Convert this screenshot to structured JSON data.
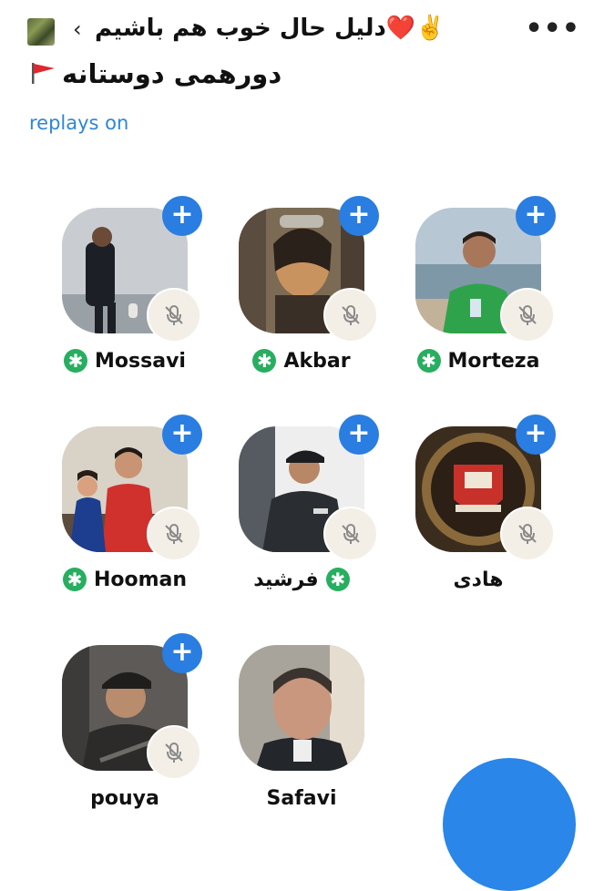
{
  "header": {
    "club_name": "دلیل حال خوب هم باشیم❤️✌️",
    "back_icon": "chevron-left-icon",
    "more_label": "•••"
  },
  "room": {
    "title": "دورهمی دوستانه",
    "flag_icon": "red-flag-icon",
    "replays": "replays on"
  },
  "speakers": [
    {
      "name": "Mossavi",
      "moderator": true,
      "muted": true,
      "follow_button": "+"
    },
    {
      "name": "Akbar",
      "moderator": true,
      "muted": true,
      "follow_button": "+"
    },
    {
      "name": "Morteza",
      "moderator": true,
      "muted": true,
      "follow_button": "+"
    },
    {
      "name": "Hooman",
      "moderator": true,
      "muted": true,
      "follow_button": "+"
    },
    {
      "name": "فرشید",
      "moderator": true,
      "muted": true,
      "follow_button": "+"
    },
    {
      "name": "هادی",
      "moderator": false,
      "muted": true,
      "follow_button": "+"
    },
    {
      "name": "pouya",
      "moderator": false,
      "muted": true,
      "follow_button": "+"
    },
    {
      "name": "Safavi",
      "moderator": false,
      "muted": false,
      "follow_button": ""
    }
  ],
  "moderator_badge": "✱",
  "colors": {
    "accent": "#2a7de1",
    "link": "#2e86d6",
    "moderator_green": "#27ae60",
    "mute_badge_bg": "#f3efe6"
  }
}
